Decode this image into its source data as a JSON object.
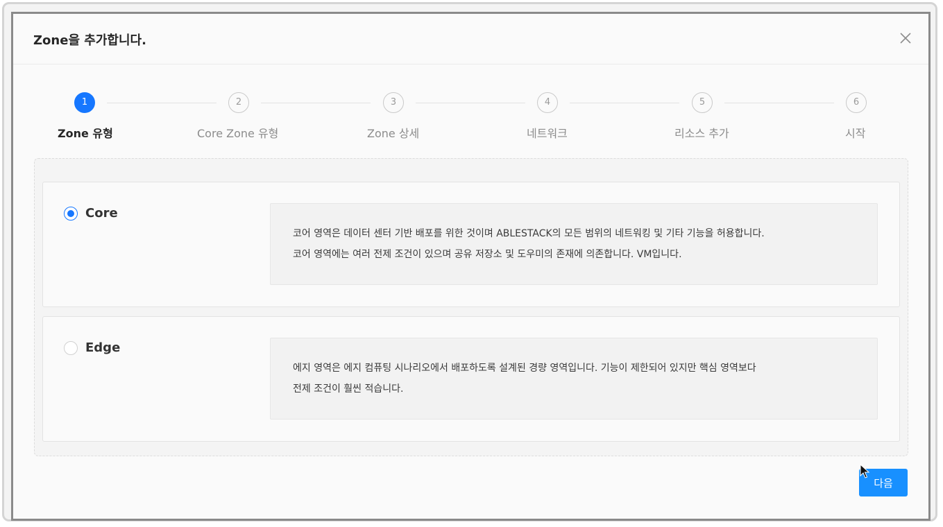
{
  "modal": {
    "title": "Zone을 추가합니다.",
    "close_icon": "close-icon"
  },
  "steps": [
    {
      "number": "1",
      "label": "Zone 유형",
      "active": true
    },
    {
      "number": "2",
      "label": "Core Zone 유형",
      "active": false
    },
    {
      "number": "3",
      "label": "Zone 상세",
      "active": false
    },
    {
      "number": "4",
      "label": "네트워크",
      "active": false
    },
    {
      "number": "5",
      "label": "리소스 추가",
      "active": false
    },
    {
      "number": "6",
      "label": "시작",
      "active": false
    }
  ],
  "options": [
    {
      "label": "Core",
      "selected": true,
      "description": [
        "코어 영역은 데이터 센터 기반 배포를 위한 것이며 ABLESTACK의 모든 범위의 네트워킹 및 기타 기능을 허용합니다.",
        "코어 영역에는 여러 전제 조건이 있으며 공유 저장소 및 도우미의 존재에 의존합니다. VM입니다."
      ]
    },
    {
      "label": "Edge",
      "selected": false,
      "description": [
        "에지 영역은 에지 컴퓨팅 시나리오에서 배포하도록 설계된 경량 영역입니다. 기능이 제한되어 있지만 핵심 영역보다",
        "전제 조건이 훨씬 적습니다."
      ]
    }
  ],
  "footer": {
    "next_label": "다음"
  },
  "colors": {
    "accent": "#1677ff",
    "button": "#1890ff"
  }
}
